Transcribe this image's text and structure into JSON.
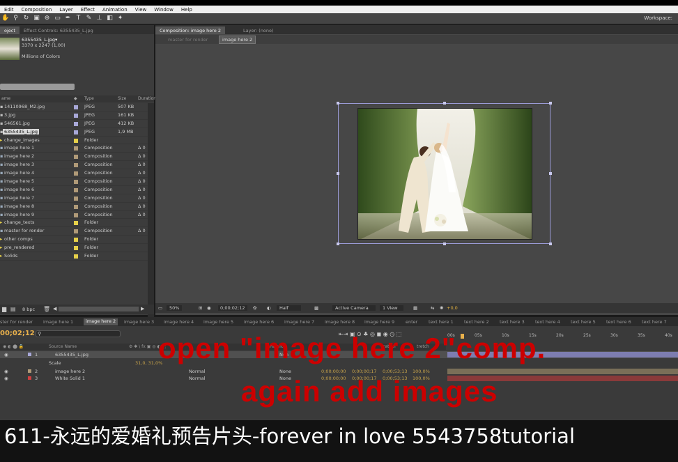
{
  "menu": [
    "Edit",
    "Composition",
    "Layer",
    "Effect",
    "Animation",
    "View",
    "Window",
    "Help"
  ],
  "toolbar": {
    "workspace_label": "Workspace:"
  },
  "project_panel": {
    "tabs": [
      "oject",
      "Effect Controls: 6355435_L.jpg"
    ],
    "selected_item": {
      "name": "6355435_L.jpg▾",
      "dimensions": "3370 x 2247 (1,00)",
      "colors": "Millions of Colors"
    },
    "columns": {
      "name": "ame",
      "type": "Type",
      "size": "Size",
      "duration": "Duration"
    },
    "items": [
      {
        "name": "14110968_M2.jpg",
        "type": "JPEG",
        "size": "507 KB",
        "dur": "",
        "color": "#a8a8d8"
      },
      {
        "name": "3.jpg",
        "type": "JPEG",
        "size": "161 KB",
        "dur": "",
        "color": "#a8a8d8"
      },
      {
        "name": "546561.jpg",
        "type": "JPEG",
        "size": "412 KB",
        "dur": "",
        "color": "#a8a8d8"
      },
      {
        "name": "6355435_L.jpg",
        "type": "JPEG",
        "size": "1,9 MB",
        "dur": "",
        "color": "#a8a8d8",
        "selected": true
      },
      {
        "name": "change_images",
        "type": "Folder",
        "size": "",
        "dur": "",
        "color": "#e6d04a"
      },
      {
        "name": "image here 1",
        "type": "Composition",
        "size": "",
        "dur": "Δ 0",
        "color": "#b09a78"
      },
      {
        "name": "image here 2",
        "type": "Composition",
        "size": "",
        "dur": "Δ 0",
        "color": "#b09a78"
      },
      {
        "name": "image here 3",
        "type": "Composition",
        "size": "",
        "dur": "Δ 0",
        "color": "#b09a78"
      },
      {
        "name": "image here 4",
        "type": "Composition",
        "size": "",
        "dur": "Δ 0",
        "color": "#b09a78"
      },
      {
        "name": "image here 5",
        "type": "Composition",
        "size": "",
        "dur": "Δ 0",
        "color": "#b09a78"
      },
      {
        "name": "image here 6",
        "type": "Composition",
        "size": "",
        "dur": "Δ 0",
        "color": "#b09a78"
      },
      {
        "name": "image here 7",
        "type": "Composition",
        "size": "",
        "dur": "Δ 0",
        "color": "#b09a78"
      },
      {
        "name": "image here 8",
        "type": "Composition",
        "size": "",
        "dur": "Δ 0",
        "color": "#b09a78"
      },
      {
        "name": "image here 9",
        "type": "Composition",
        "size": "",
        "dur": "Δ 0",
        "color": "#b09a78"
      },
      {
        "name": "change_texts",
        "type": "Folder",
        "size": "",
        "dur": "",
        "color": "#e6d04a"
      },
      {
        "name": "master for render",
        "type": "Composition",
        "size": "",
        "dur": "Δ 0",
        "color": "#b09a78"
      },
      {
        "name": "other comps",
        "type": "Folder",
        "size": "",
        "dur": "",
        "color": "#e6d04a"
      },
      {
        "name": "pre_rendered",
        "type": "Folder",
        "size": "",
        "dur": "",
        "color": "#e6d04a"
      },
      {
        "name": "Solids",
        "type": "Folder",
        "size": "",
        "dur": "",
        "color": "#e6d04a"
      }
    ],
    "bpc": "8 bpc"
  },
  "comp_panel": {
    "tabs": [
      "Composition: image here 2",
      "Layer: (none)"
    ],
    "crumbs": [
      "master for render",
      "image here 2"
    ],
    "footer": {
      "zoom": "50%",
      "time": "0;00;02;12",
      "resolution": "Half",
      "camera": "Active Camera",
      "view": "1 View",
      "exposure": "+0,0"
    }
  },
  "timeline": {
    "tabs": [
      "ster for render",
      "image here 1",
      "image here 2",
      "image here 3",
      "image here 4",
      "image here 5",
      "image here 6",
      "image here 7",
      "image here 8",
      "image here 9",
      "enter",
      "text here 1",
      "text here 2",
      "text here 3",
      "text here 4",
      "text here 5",
      "text here 6",
      "text here 7"
    ],
    "timecode": "00;02;12",
    "ruler": [
      "00s",
      "05s",
      "10s",
      "15s",
      "20s",
      "25s",
      "30s",
      "35s",
      "40s"
    ],
    "columns": {
      "source": "Source Name",
      "parent": "Parent",
      "duration": "ration",
      "stretch": "tretch"
    },
    "layers": [
      {
        "num": "1",
        "name": "6355435_L.jpg",
        "mode": "",
        "parent": "Non",
        "in": "",
        "out": "",
        "dur": "",
        "stretch": ""
      },
      {
        "num": "2",
        "name": "image here 2",
        "mode": "Normal",
        "parent": "None",
        "in": "0;00;00;00",
        "out": "0;00;00;17",
        "dur": "0;00;53;13",
        "stretch": "100,0%"
      },
      {
        "num": "3",
        "name": "White Solid 1",
        "mode": "Normal",
        "parent": "None",
        "in": "0;00;00;00",
        "out": "0;00;00;17",
        "dur": "0;00;53;13",
        "stretch": "100,0%"
      }
    ],
    "scale_label": "Scale",
    "scale_value": "31,0, 31,0%"
  },
  "overlay": {
    "line1": "open  \"image here 2\"comp.",
    "line2": "again add images",
    "subtitle": "611-永远的爱婚礼预告片头-forever in love 5543758tutorial"
  }
}
